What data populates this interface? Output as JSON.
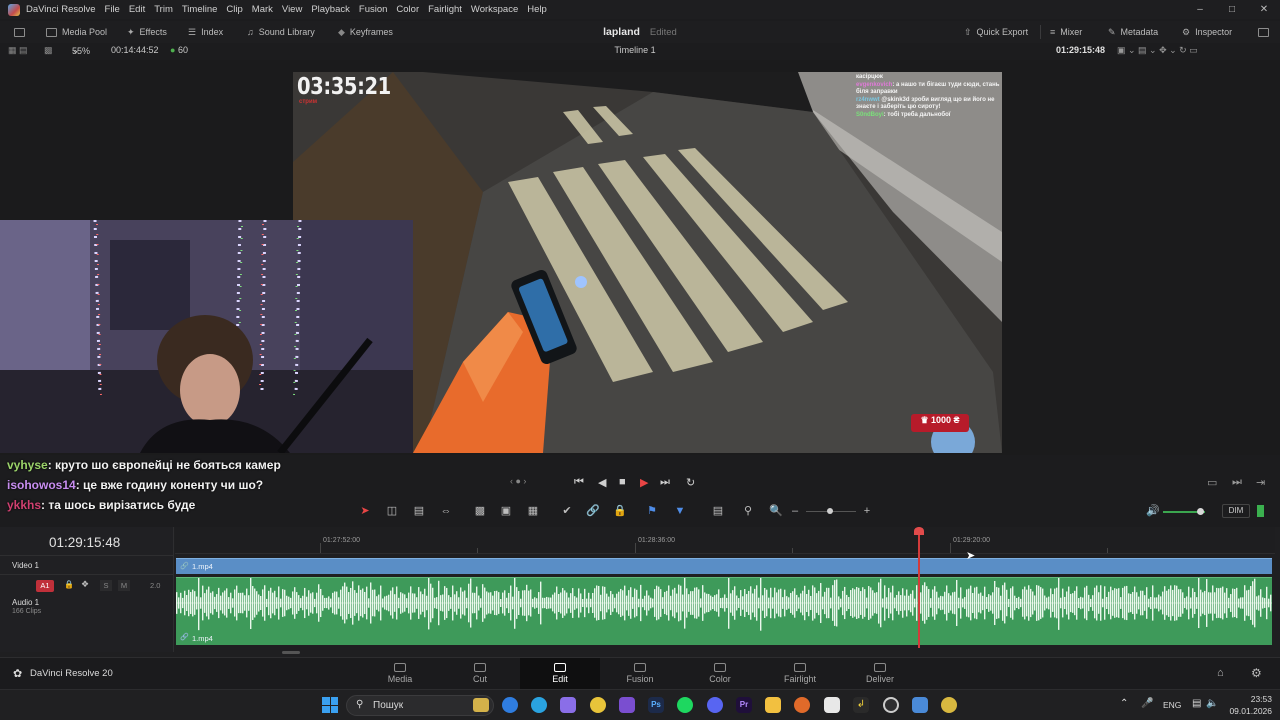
{
  "app": {
    "name": "DaVinci Resolve",
    "version_label": "DaVinci Resolve 20",
    "menu": [
      "File",
      "Edit",
      "Trim",
      "Timeline",
      "Clip",
      "Mark",
      "View",
      "Playback",
      "Fusion",
      "Color",
      "Fairlight",
      "Workspace",
      "Help"
    ]
  },
  "toolbar": {
    "left": [
      "Media Pool",
      "Effects",
      "Index",
      "Sound Library",
      "Keyframes"
    ],
    "project_name": "lapland",
    "project_status": "Edited",
    "right": [
      "Quick Export",
      "Mixer",
      "Metadata",
      "Inspector"
    ]
  },
  "viewer": {
    "zoom": "55%",
    "source_timecode": "00:14:44:52",
    "fps": "60",
    "timeline_name": "Timeline 1",
    "record_timecode": "01:29:15:48",
    "overlay_timer": "03:35:21",
    "overlay_timer_sub": "стрим",
    "overlay_chat": [
      {
        "user": "",
        "text": "касірцюк"
      },
      {
        "user": "evgenkovich",
        "text": "а нашо ти бігаєш туди сюди, стань біля заправки"
      },
      {
        "user": "rz4nwwt",
        "text": "@skink3d зроби вигляд що ви його не знаєте і заберіть цю сироту!"
      },
      {
        "user": "S0ndBoyi",
        "text": "тобі треба дальнобої"
      }
    ],
    "badge_label": "1000 ₴"
  },
  "subtitle_chat": [
    {
      "user": "vyhyse",
      "text": "круто шо європейці не бояться камер"
    },
    {
      "user": "isohowos14",
      "text": "це вже годину коненту чи шо?"
    },
    {
      "user": "ykkhs",
      "text": "та шось вирізатись буде"
    }
  ],
  "transport": {
    "dim_label": "DIM"
  },
  "timeline": {
    "current_timecode": "01:29:15:48",
    "ruler_labels": [
      "01:27:52:00",
      "01:28:36:00",
      "01:29:20:00"
    ],
    "video_track": {
      "name": "Video 1",
      "clip_name": "1.mp4"
    },
    "audio_track": {
      "name": "Audio 1",
      "id": "A1",
      "channels": "2.0",
      "clips_count": "166 Clips",
      "clip_name": "1.mp4",
      "solo": "S",
      "mute": "M"
    }
  },
  "pages": [
    {
      "label": "Media",
      "active": false
    },
    {
      "label": "Cut",
      "active": false
    },
    {
      "label": "Edit",
      "active": true
    },
    {
      "label": "Fusion",
      "active": false
    },
    {
      "label": "Color",
      "active": false
    },
    {
      "label": "Fairlight",
      "active": false
    },
    {
      "label": "Deliver",
      "active": false
    }
  ],
  "taskbar": {
    "search_placeholder": "Пошук",
    "language": "ENG",
    "time": "23:53",
    "date": "09.01.2026"
  },
  "colors": {
    "accent_red": "#d33b3b",
    "video_clip": "#5a8ec6",
    "audio_clip": "#3e9a5a"
  }
}
